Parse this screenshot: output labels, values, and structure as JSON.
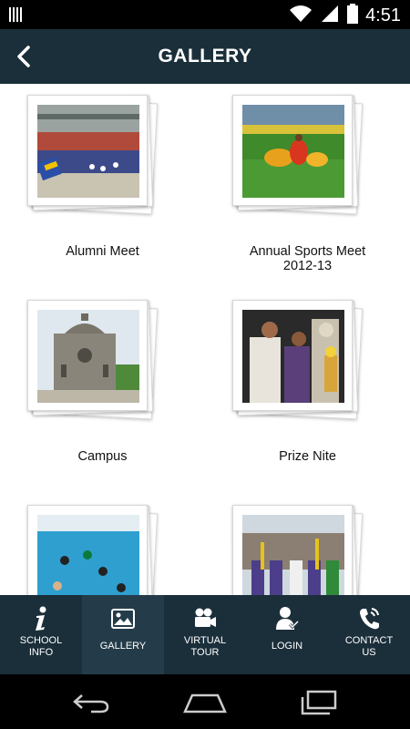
{
  "status_bar": {
    "time": "4:51",
    "icons": [
      "signal-bars-icon",
      "wifi-icon",
      "cellular-icon",
      "battery-icon"
    ]
  },
  "header": {
    "title": "GALLERY",
    "back_icon": "chevron-left-icon"
  },
  "albums": [
    {
      "label": "Alumni Meet",
      "image": "alumni-meet-photo"
    },
    {
      "label": "Annual Sports Meet\n2012-13",
      "image": "sports-meet-photo"
    },
    {
      "label": "Campus",
      "image": "campus-photo"
    },
    {
      "label": "Prize Nite",
      "image": "prize-nite-photo"
    },
    {
      "label": "",
      "image": "swimming-photo"
    },
    {
      "label": "",
      "image": "parade-photo"
    }
  ],
  "bottom_nav": [
    {
      "label": "SCHOOL\nINFO",
      "icon": "info-icon",
      "active": false
    },
    {
      "label": "GALLERY",
      "icon": "gallery-icon",
      "active": true
    },
    {
      "label": "VIRTUAL\nTOUR",
      "icon": "video-camera-icon",
      "active": false
    },
    {
      "label": "LOGIN",
      "icon": "user-icon",
      "active": false
    },
    {
      "label": "CONTACT\nUS",
      "icon": "phone-icon",
      "active": false
    }
  ],
  "colors": {
    "header_bg": "#1b2f3a",
    "nav_active_bg": "#243c49",
    "content_bg": "#ffffff"
  }
}
